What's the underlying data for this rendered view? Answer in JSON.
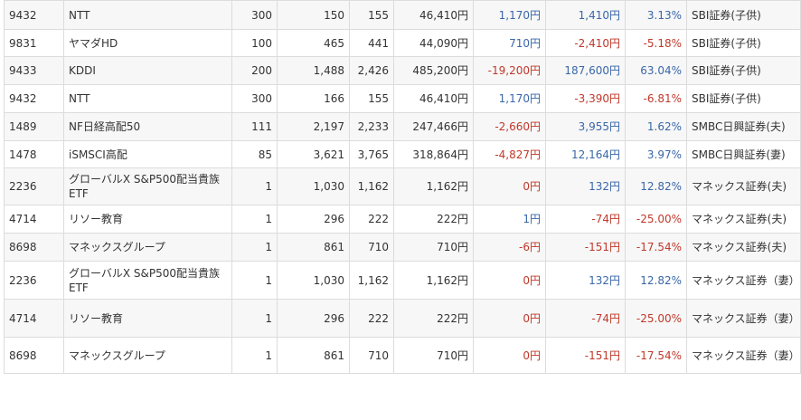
{
  "colors": {
    "positive": "#3a67a8",
    "negative": "#c0392b",
    "text": "#333333",
    "row_alt_bg": "#f7f7f7"
  },
  "rows": [
    {
      "code": "9432",
      "name": "NTT",
      "qty": "300",
      "buy": "150",
      "price": "155",
      "value": "46,410円",
      "day": "1,170円",
      "day_sign": "pos",
      "gain": "1,410円",
      "gain_sign": "pos",
      "pct": "3.13%",
      "account": "SBI証券(子供)"
    },
    {
      "code": "9831",
      "name": "ヤマダHD",
      "qty": "100",
      "buy": "465",
      "price": "441",
      "value": "44,090円",
      "day": "710円",
      "day_sign": "pos",
      "gain": "-2,410円",
      "gain_sign": "neg",
      "pct": "-5.18%",
      "account": "SBI証券(子供)"
    },
    {
      "code": "9433",
      "name": "KDDI",
      "qty": "200",
      "buy": "1,488",
      "price": "2,426",
      "value": "485,200円",
      "day": "-19,200円",
      "day_sign": "neg",
      "gain": "187,600円",
      "gain_sign": "pos",
      "pct": "63.04%",
      "account": "SBI証券(子供)"
    },
    {
      "code": "9432",
      "name": "NTT",
      "qty": "300",
      "buy": "166",
      "price": "155",
      "value": "46,410円",
      "day": "1,170円",
      "day_sign": "pos",
      "gain": "-3,390円",
      "gain_sign": "neg",
      "pct": "-6.81%",
      "account": "SBI証券(子供)"
    },
    {
      "code": "1489",
      "name": "NF日経高配50",
      "qty": "111",
      "buy": "2,197",
      "price": "2,233",
      "value": "247,466円",
      "day": "-2,660円",
      "day_sign": "neg",
      "gain": "3,955円",
      "gain_sign": "pos",
      "pct": "1.62%",
      "account": "SMBC日興証券(夫)"
    },
    {
      "code": "1478",
      "name": "iSMSCI高配",
      "qty": "85",
      "buy": "3,621",
      "price": "3,765",
      "value": "318,864円",
      "day": "-4,827円",
      "day_sign": "neg",
      "gain": "12,164円",
      "gain_sign": "pos",
      "pct": "3.97%",
      "account": "SMBC日興証券(妻)"
    },
    {
      "code": "2236",
      "name": "グローバルX S&P500配当貴族ETF",
      "qty": "1",
      "buy": "1,030",
      "price": "1,162",
      "value": "1,162円",
      "day": "0円",
      "day_sign": "zero",
      "gain": "132円",
      "gain_sign": "pos",
      "pct": "12.82%",
      "account": "マネックス証券(夫)"
    },
    {
      "code": "4714",
      "name": "リソー教育",
      "qty": "1",
      "buy": "296",
      "price": "222",
      "value": "222円",
      "day": "1円",
      "day_sign": "pos",
      "gain": "-74円",
      "gain_sign": "neg",
      "pct": "-25.00%",
      "account": "マネックス証券(夫)"
    },
    {
      "code": "8698",
      "name": "マネックスグループ",
      "qty": "1",
      "buy": "861",
      "price": "710",
      "value": "710円",
      "day": "-6円",
      "day_sign": "neg",
      "gain": "-151円",
      "gain_sign": "neg",
      "pct": "-17.54%",
      "account": "マネックス証券(夫)"
    },
    {
      "code": "2236",
      "name": "グローバルX S&P500配当貴族ETF",
      "qty": "1",
      "buy": "1,030",
      "price": "1,162",
      "value": "1,162円",
      "day": "0円",
      "day_sign": "zero",
      "gain": "132円",
      "gain_sign": "pos",
      "pct": "12.82%",
      "account": "マネックス証券（妻）"
    },
    {
      "code": "4714",
      "name": "リソー教育",
      "qty": "1",
      "buy": "296",
      "price": "222",
      "value": "222円",
      "day": "0円",
      "day_sign": "zero",
      "gain": "-74円",
      "gain_sign": "neg",
      "pct": "-25.00%",
      "account": "マネックス証券（妻）"
    },
    {
      "code": "8698",
      "name": "マネックスグループ",
      "qty": "1",
      "buy": "861",
      "price": "710",
      "value": "710円",
      "day": "0円",
      "day_sign": "zero",
      "gain": "-151円",
      "gain_sign": "neg",
      "pct": "-17.54%",
      "account": "マネックス証券（妻）"
    }
  ]
}
